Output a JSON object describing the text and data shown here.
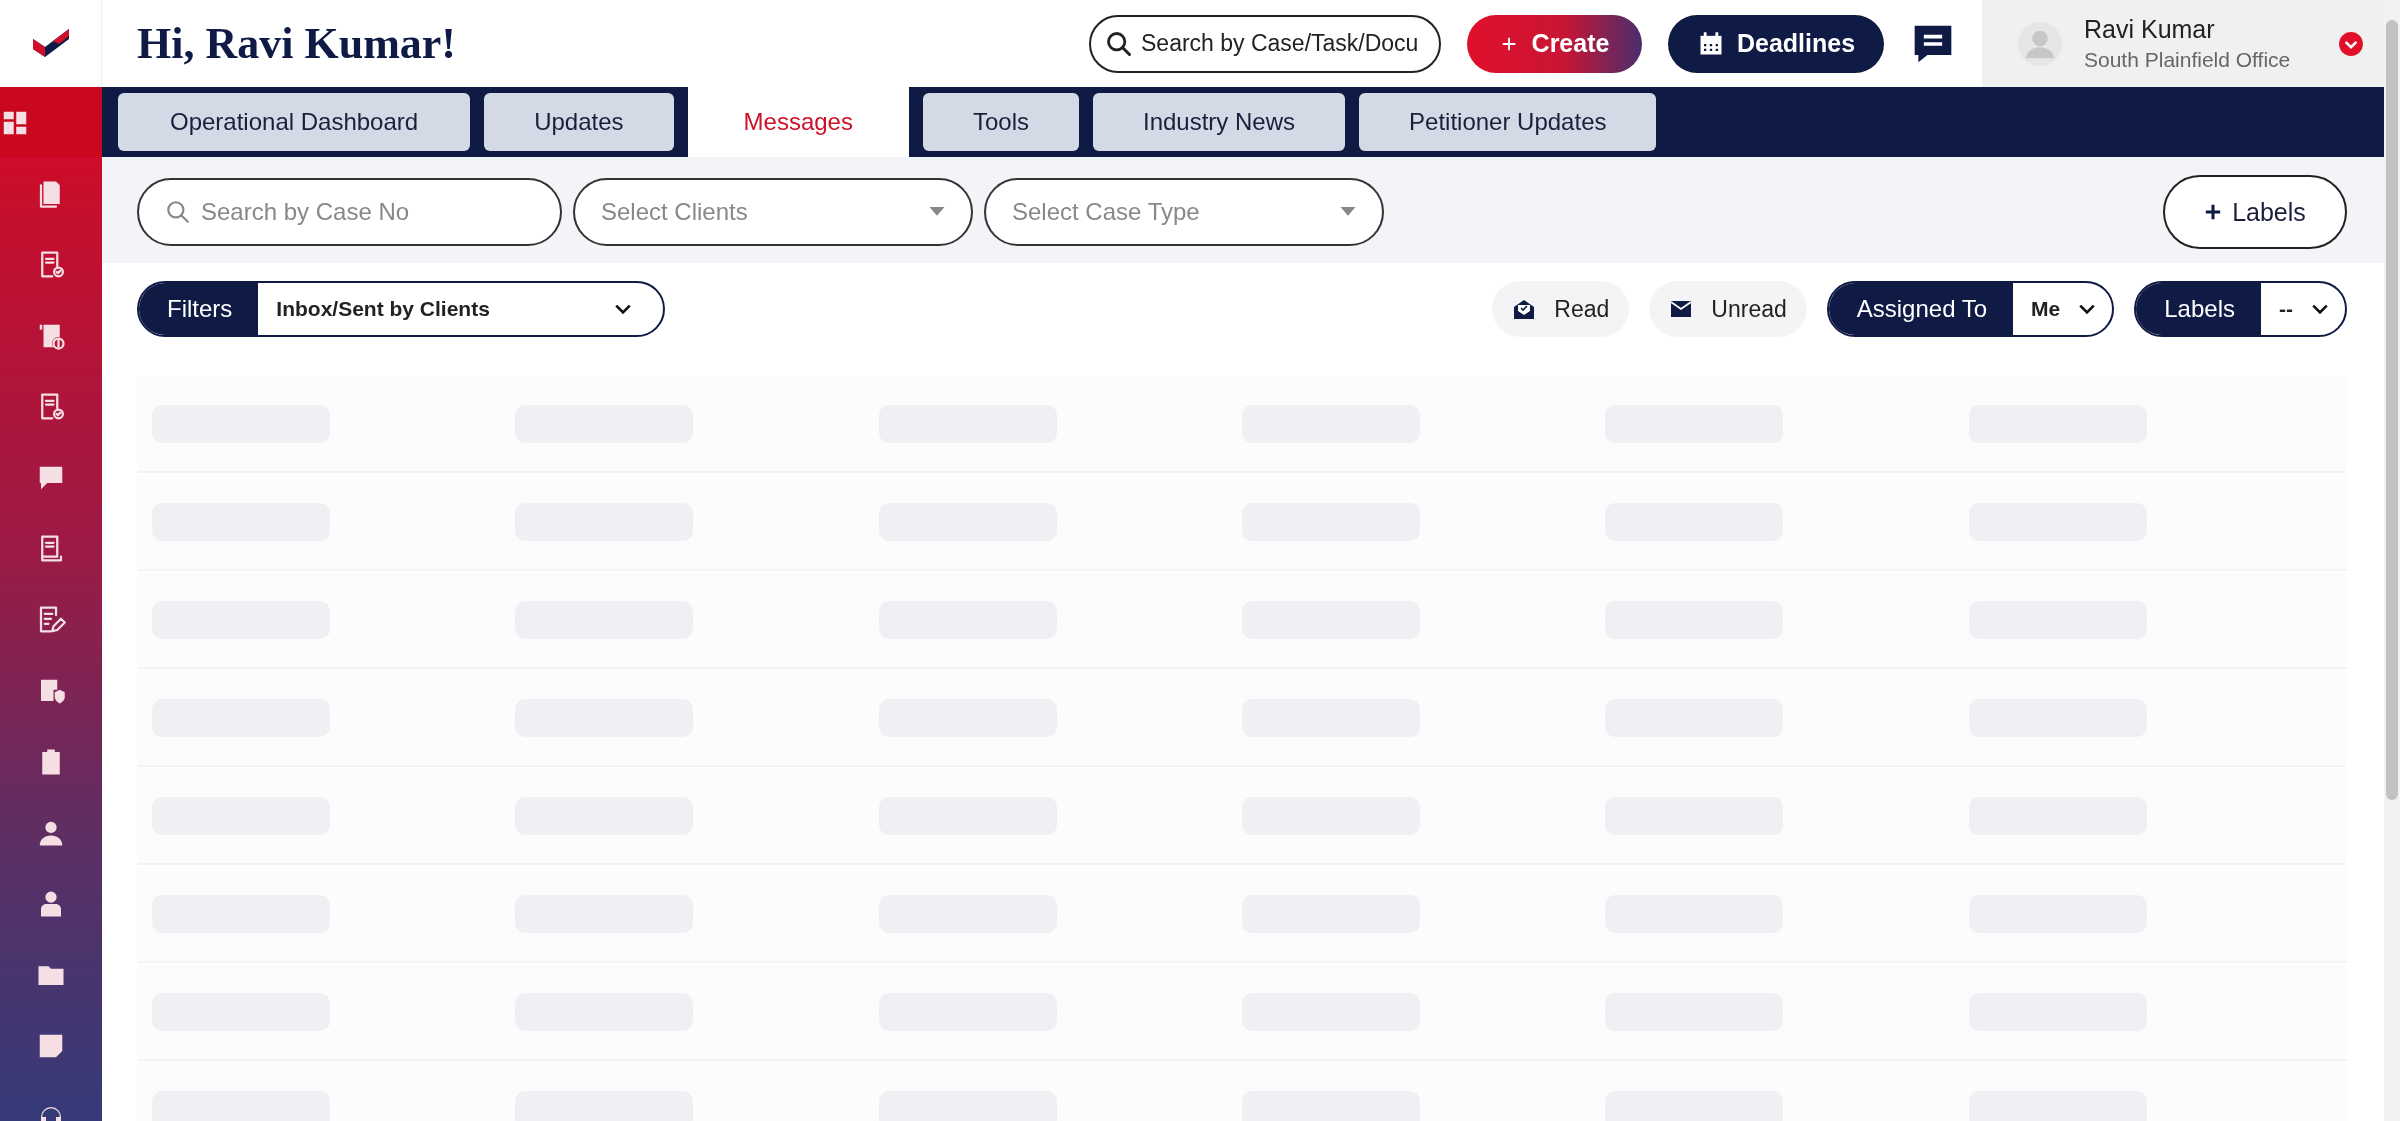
{
  "header": {
    "greeting": "Hi, Ravi Kumar!",
    "search": {
      "placeholder": "Search by Case/Task/Docu"
    },
    "create_button": "Create",
    "deadlines_button": "Deadlines",
    "user": {
      "name": "Ravi Kumar",
      "office": "South Plainfield Office"
    }
  },
  "sidebar": {
    "items": [
      {
        "selected": true
      },
      {
        "selected": false
      },
      {
        "selected": false
      },
      {
        "selected": false
      },
      {
        "selected": false
      },
      {
        "selected": false
      },
      {
        "selected": false
      },
      {
        "selected": false
      },
      {
        "selected": false
      },
      {
        "selected": false
      },
      {
        "selected": false
      },
      {
        "selected": false
      },
      {
        "selected": false
      },
      {
        "selected": false
      },
      {
        "selected": false
      }
    ]
  },
  "tabs": [
    {
      "label": "Operational Dashboard",
      "selected": false
    },
    {
      "label": "Updates",
      "selected": false
    },
    {
      "label": "Messages",
      "selected": true
    },
    {
      "label": "Tools",
      "selected": false
    },
    {
      "label": "Industry News",
      "selected": false
    },
    {
      "label": "Petitioner Updates",
      "selected": false
    }
  ],
  "filters": {
    "case_search": {
      "placeholder": "Search by Case No"
    },
    "clients_select": {
      "placeholder": "Select Clients"
    },
    "case_type_select": {
      "placeholder": "Select Case Type"
    },
    "labels_button": "Labels",
    "filter": {
      "label": "Filters",
      "value": "Inbox/Sent by Clients"
    },
    "read_button": "Read",
    "unread_button": "Unread",
    "assigned_to": {
      "label": "Assigned To",
      "value": "Me"
    },
    "labels_filter": {
      "label": "Labels",
      "value": "--"
    }
  },
  "table": {
    "loading": true
  }
}
